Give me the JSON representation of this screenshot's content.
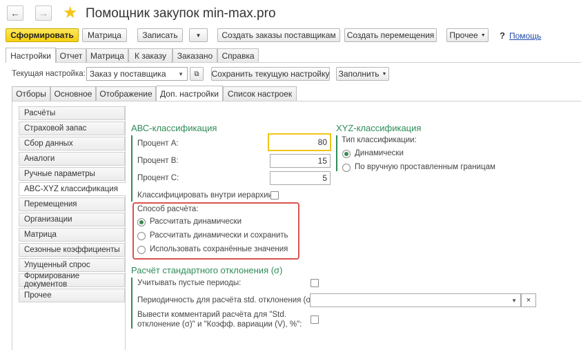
{
  "window": {
    "title": "Помощник закупок min-max.pro"
  },
  "toolbar": {
    "generate": "Сформировать",
    "matrix": "Матрица",
    "save": "Записать",
    "create_orders": "Создать заказы поставщикам",
    "create_moves": "Создать перемещения",
    "other": "Прочее",
    "help_mark": "?",
    "help": "Помощь"
  },
  "main_tabs": [
    "Настройки",
    "Отчет",
    "Матрица",
    "К заказу",
    "Заказано",
    "Справка"
  ],
  "settings_bar": {
    "current_label": "Текущая настройка:",
    "current_value": "Заказ у поставщика",
    "save_current": "Сохранить текущую настройку",
    "fill": "Заполнить"
  },
  "sub_tabs": [
    "Отборы",
    "Основное",
    "Отображение",
    "Доп. настройки",
    "Список  настроек"
  ],
  "sidebar": [
    "Расчёты",
    "Страховой запас",
    "Сбор данных",
    "Аналоги",
    "Ручные параметры",
    "ABC-XYZ классификация",
    "Перемещения",
    "Организации",
    "Матрица",
    "Сезонные коэффициенты",
    "Упущенный спрос",
    "Формирование документов",
    "Прочее"
  ],
  "abc": {
    "title": "АВС-классификация",
    "percent_a_label": "Процент А:",
    "percent_a": "80",
    "percent_b_label": "Процент В:",
    "percent_b": "15",
    "percent_c_label": "Процент С:",
    "percent_c": "5",
    "hierarchy_label": "Классифицировать внутри иерархии:",
    "method_label": "Способ расчёта:",
    "methods": [
      "Рассчитать динамически",
      "Рассчитать динамически и сохранить",
      "Использовать сохранённые значения"
    ]
  },
  "xyz": {
    "title": "XYZ-классификация",
    "type_label": "Тип классификации:",
    "options": [
      "Динамически",
      "По вручную проставленным границам"
    ]
  },
  "stddev": {
    "title": "Расчёт стандартного отклонения (σ)",
    "empty_periods_label": "Учитывать пустые периоды:",
    "periodicity_label": "Периодичность для расчёта std. отклонения (σ):",
    "periodicity_value": "",
    "comment_label_1": "Вывести комментарий расчёта для \"Std.",
    "comment_label_2": "отклонение (σ)\" и \"Коэфф. вариации (V), %\":"
  },
  "colors": {
    "accent_green": "#2e8b57",
    "highlight_red": "#d9534f",
    "primary_yellow": "#f6cf12",
    "star": "#f5c518"
  }
}
